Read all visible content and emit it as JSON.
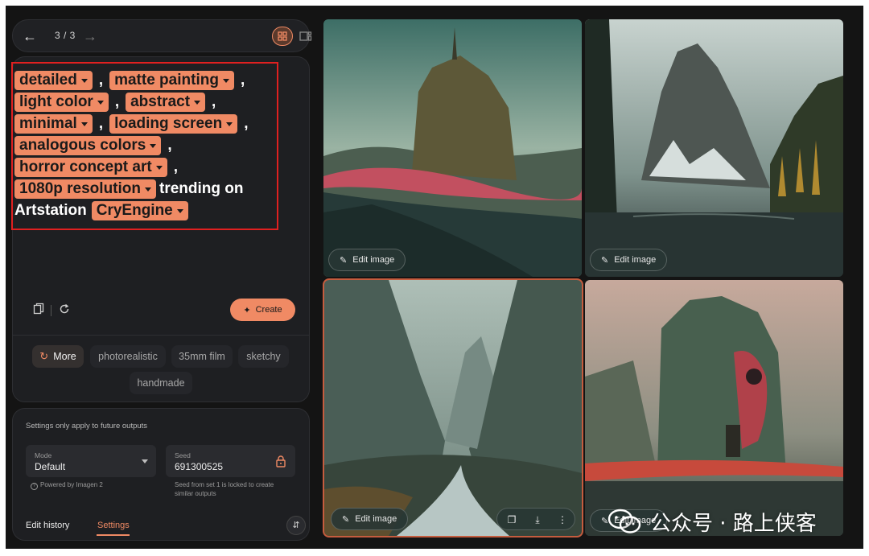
{
  "nav": {
    "counter": "3 / 3",
    "back_icon": "arrow-left-icon",
    "forward_icon": "arrow-right-icon",
    "view_grid_icon": "grid-view-icon",
    "view_single_icon": "single-view-icon"
  },
  "prompt": {
    "lines": [
      [
        {
          "chip": "detailed"
        },
        {
          "sep": ","
        },
        {
          "chip": "matte painting"
        },
        {
          "sep": ","
        }
      ],
      [
        {
          "chip": "light color"
        },
        {
          "sep": ","
        },
        {
          "chip": "abstract"
        },
        {
          "sep": ","
        }
      ],
      [
        {
          "chip": "minimal"
        },
        {
          "sep": ","
        },
        {
          "chip": "loading screen"
        },
        {
          "sep": ","
        }
      ],
      [
        {
          "chip": "analogous colors"
        },
        {
          "sep": ","
        }
      ],
      [
        {
          "chip": "horror concept art"
        },
        {
          "sep": ","
        }
      ],
      [
        {
          "chip": "1080p resolution"
        },
        {
          "text": "trending on"
        }
      ],
      [
        {
          "text": "Artstation"
        },
        {
          "chip": "CryEngine"
        }
      ]
    ]
  },
  "actions": {
    "copy_icon": "copy-icon",
    "reset_icon": "refresh-icon",
    "create_label": "Create",
    "create_icon": "sparkle-icon"
  },
  "suggestions": {
    "more_label": "More",
    "items": [
      "photorealistic",
      "35mm film",
      "sketchy",
      "handmade"
    ]
  },
  "settings": {
    "note": "Settings only apply to future outputs",
    "mode_label": "Mode",
    "mode_value": "Default",
    "powered_by": "Powered by Imagen 2",
    "seed_label": "Seed",
    "seed_value": "691300525",
    "seed_note_line1": "Seed from set 1 is locked to create",
    "seed_note_line2": "similar outputs",
    "tab_history": "Edit history",
    "tab_settings": "Settings"
  },
  "images": {
    "edit_label": "Edit image",
    "edit_icon": "magic-wand-icon",
    "tool_icons": [
      "copy-icon",
      "download-icon",
      "more-vert-icon"
    ]
  },
  "watermark": {
    "text": "公众号 · 路上侠客"
  },
  "colors": {
    "accent": "#f08a64",
    "highlight_box": "#e02020",
    "background": "#141414",
    "panel": "#1e1f22"
  }
}
